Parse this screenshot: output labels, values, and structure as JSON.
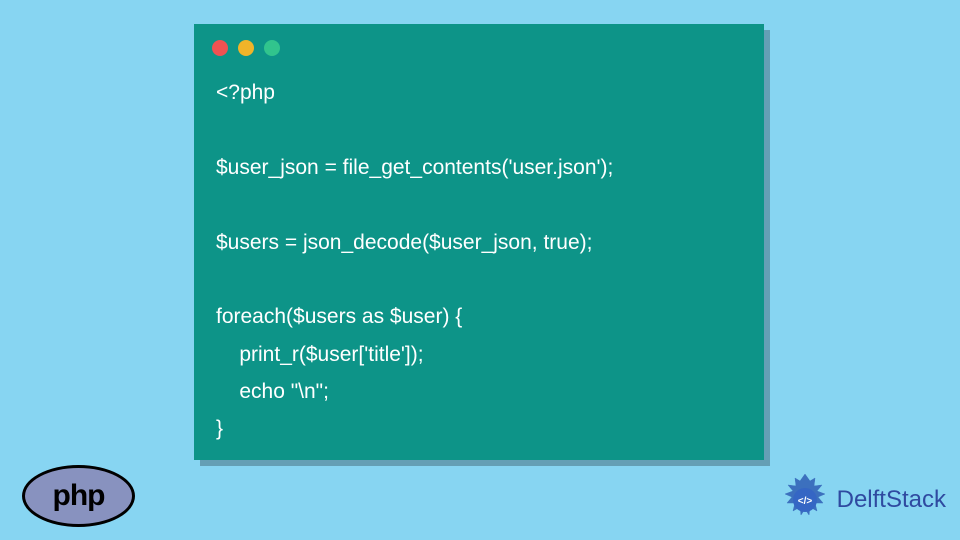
{
  "code": {
    "lines": [
      "<?php",
      "",
      "$user_json = file_get_contents('user.json');",
      "",
      "$users = json_decode($user_json, true);",
      "",
      "foreach($users as $user) {",
      "    print_r($user['title']);",
      "    echo \"\\n\";",
      "}"
    ]
  },
  "php_logo_text": "php",
  "delft_logo_text": "DelftStack"
}
